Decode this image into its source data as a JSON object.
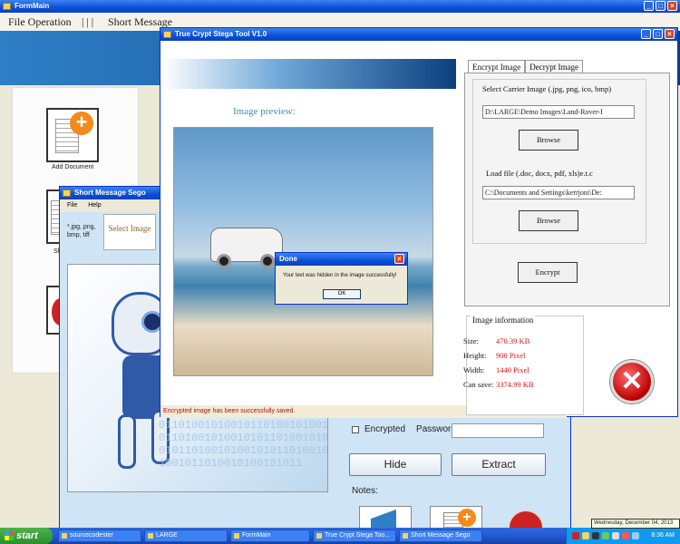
{
  "formmain": {
    "title": "FormMain",
    "menu": [
      "File Operation",
      "| | |",
      "Short Message"
    ],
    "add_document_label": "Add Document",
    "partial_label": "Sh"
  },
  "sms_window": {
    "title": "Short Message Sego",
    "menu": [
      "File",
      "Help"
    ],
    "file_types": "*.jpg, png, bmp, tiff",
    "select_image": "Select Image",
    "encrypted_label": "Encrypted",
    "password_label": "Password",
    "password_value": "",
    "hide_button": "Hide",
    "extract_button": "Extract",
    "notes_label": "Notes:"
  },
  "stega_window": {
    "title": "True Crypt Stega Tool V1.0",
    "image_preview_title": "Image preview:",
    "status_text": "Encrypted image has been successfully saved.",
    "tabs": [
      {
        "label": "Encrypt Image",
        "active": true
      },
      {
        "label": "Decrypt Image",
        "active": false
      }
    ],
    "carrier_label": "Select Carrier Image (.jpg, png, ico, bmp)",
    "carrier_path": "D:\\LARGE\\Demo Images\\Land-Rover-I",
    "browse1": "Browse",
    "load_file_label": "Load file (.doc, docx, pdf, xls)e.t.c",
    "load_file_path": "C:\\Documents and Settings\\kerrjoni\\De:",
    "browse2": "Browse",
    "encrypt_button": "Encrypt",
    "image_info": {
      "title": "Image information",
      "rows": [
        {
          "key": "Size:",
          "value": "470.39 KB"
        },
        {
          "key": "Height:",
          "value": "900 Pixel"
        },
        {
          "key": "Width:",
          "value": "1440 Pixel"
        },
        {
          "key": "Can save:",
          "value": "3374.99 KB"
        }
      ]
    }
  },
  "done_dialog": {
    "title": "Done",
    "message": "Your text was hidden in the image successfully!",
    "ok": "OK"
  },
  "taskbar": {
    "start": "start",
    "tasks": [
      "sourcecodester",
      "LARGE",
      "FormMain",
      "True Crypt Stega Too...",
      "Short Message Sego"
    ],
    "clock": "8:36 AM",
    "tooltip": "Wednesday, December 04, 2013"
  }
}
